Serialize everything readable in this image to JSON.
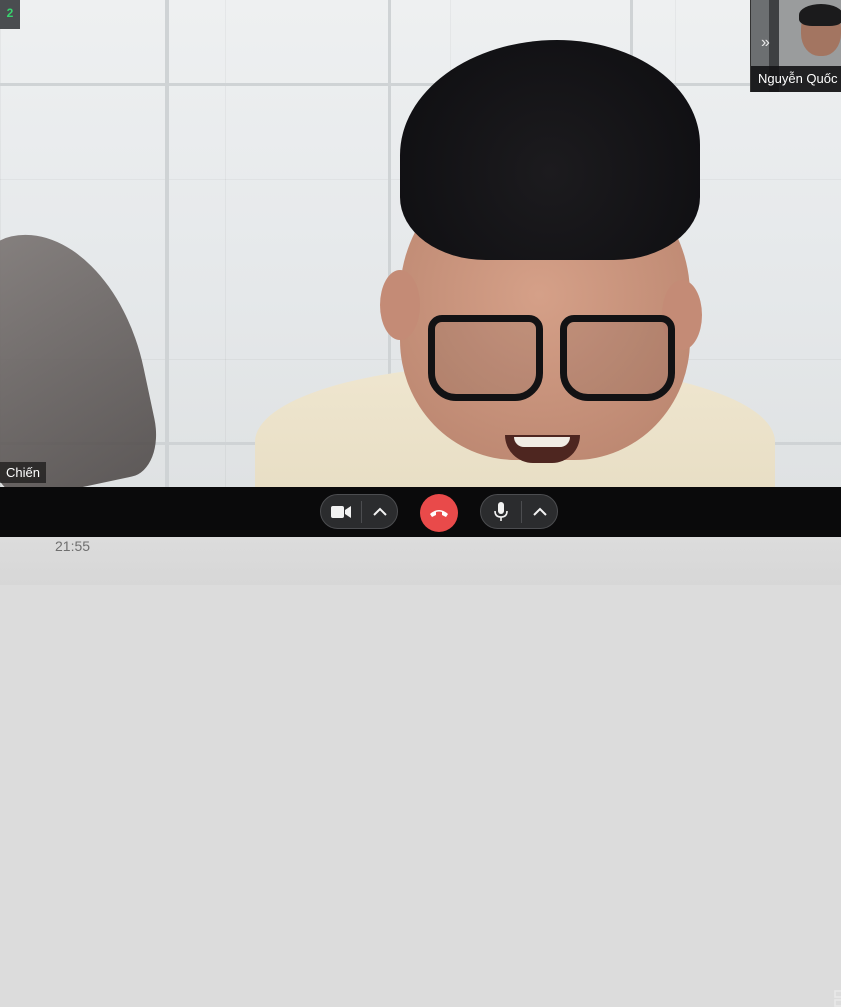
{
  "participant_count": "2",
  "main_participant_name": "Chiến",
  "thumbnail": {
    "name": "Nguyễn Quốc",
    "arrow_glyph": "»"
  },
  "toolbar": {
    "camera_icon": "camera-icon",
    "mic_icon": "microphone-icon",
    "end_call_icon": "phone-hangup-icon",
    "caret_icon": "chevron-up-icon"
  },
  "time": "21:55",
  "colors": {
    "end_call": "#e94a4a",
    "toolbar_bg": "#0a0a0b",
    "count_text": "#38d46e"
  }
}
